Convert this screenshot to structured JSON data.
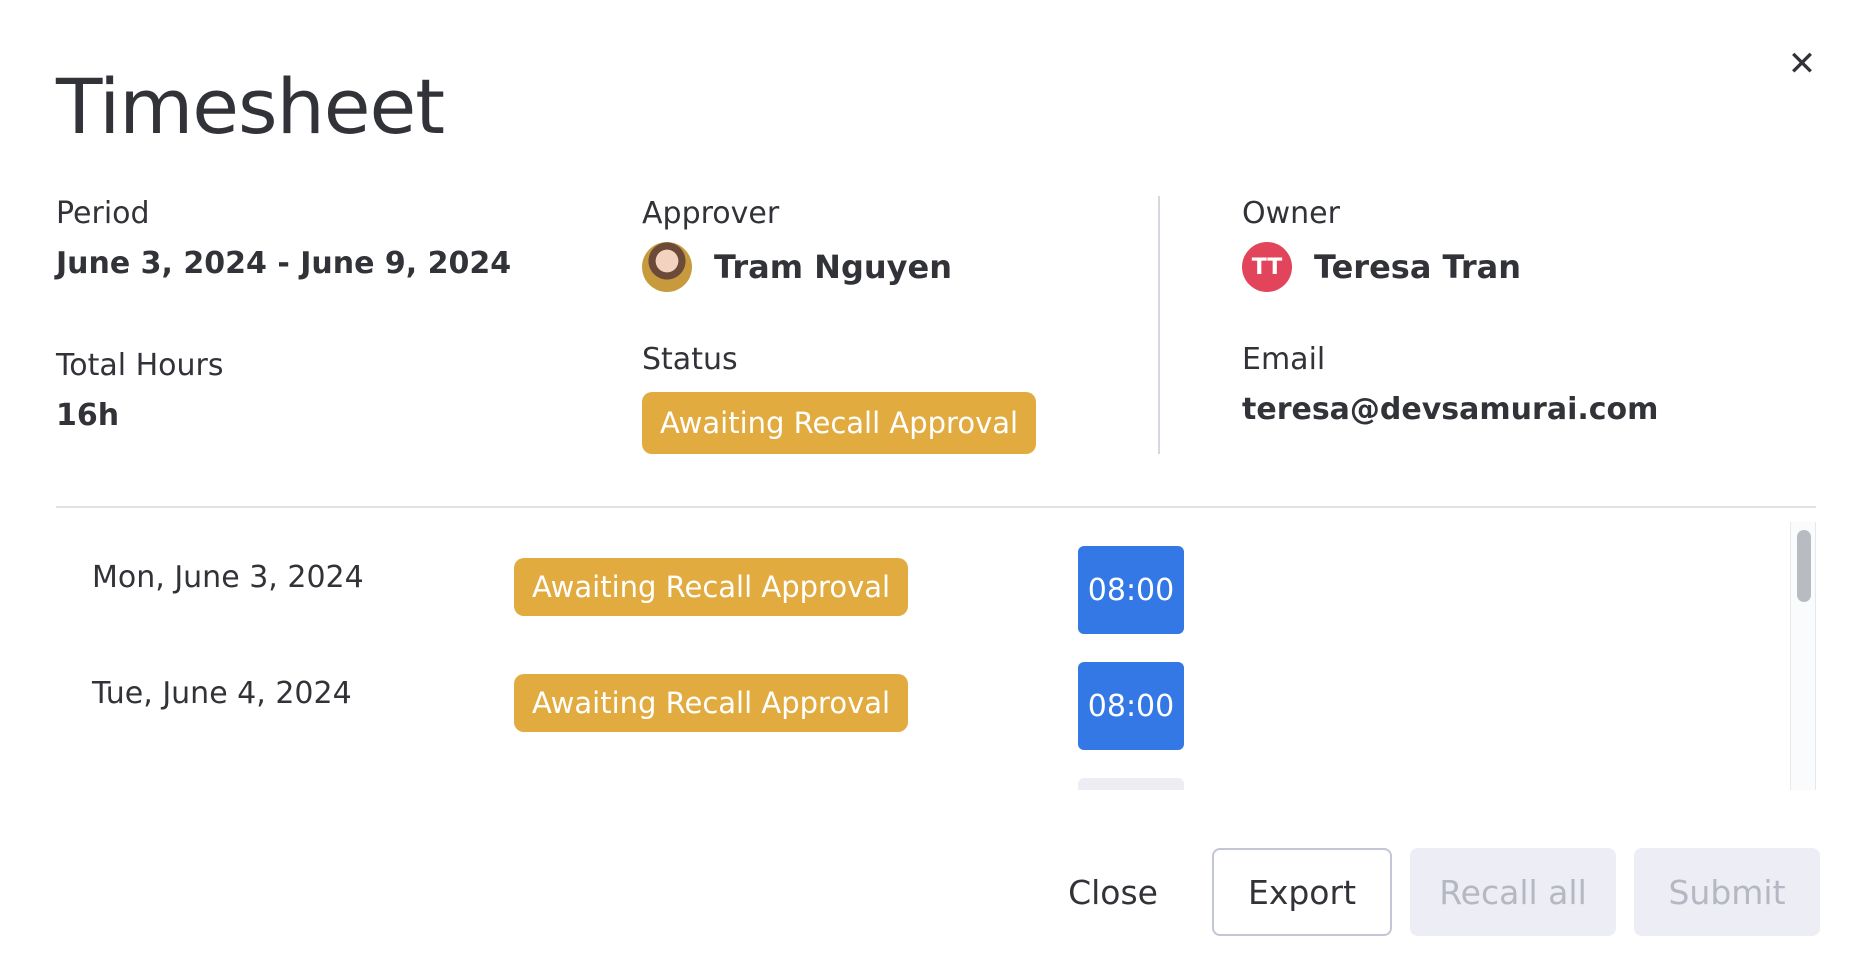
{
  "dialog": {
    "title": "Timesheet",
    "close_icon": "close-icon"
  },
  "info": {
    "period_label": "Period",
    "period_value": "June 3, 2024 - June 9, 2024",
    "total_hours_label": "Total Hours",
    "total_hours_value": "16h",
    "approver_label": "Approver",
    "approver_name": "Tram Nguyen",
    "status_label": "Status",
    "status_value": "Awaiting Recall Approval",
    "owner_label": "Owner",
    "owner_initials": "TT",
    "owner_name": "Teresa Tran",
    "email_label": "Email",
    "email_value": "teresa@devsamurai.com"
  },
  "days": [
    {
      "date": "Mon, June 3, 2024",
      "status": "Awaiting Recall Approval",
      "hours": "08:00"
    },
    {
      "date": "Tue, June 4, 2024",
      "status": "Awaiting Recall Approval",
      "hours": "08:00"
    }
  ],
  "footer": {
    "close_label": "Close",
    "export_label": "Export",
    "recall_all_label": "Recall all",
    "submit_label": "Submit"
  },
  "colors": {
    "status_badge": "#e2ab40",
    "hours_cell": "#3478e6",
    "owner_avatar": "#e2445c",
    "disabled_button": "#ecedf5"
  }
}
